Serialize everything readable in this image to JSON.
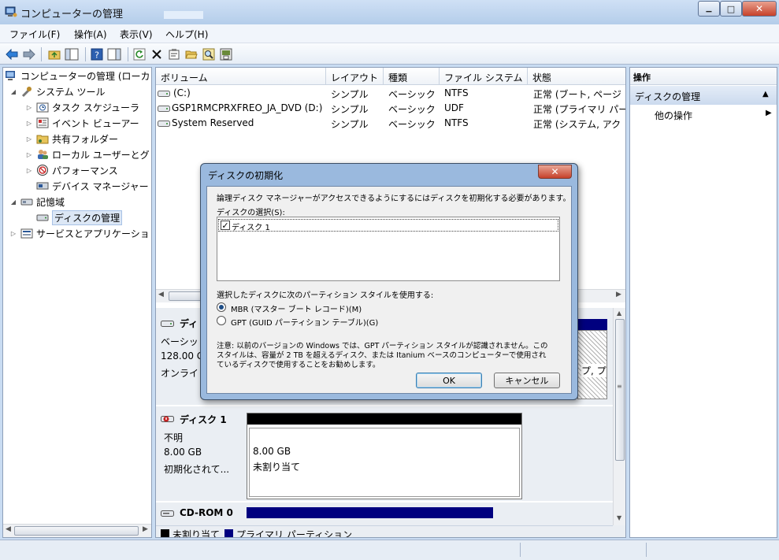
{
  "window": {
    "title": "コンピューターの管理",
    "minimize_label": "▁",
    "maximize_label": "□",
    "close_label": "✕"
  },
  "menu": [
    "ファイル(F)",
    "操作(A)",
    "表示(V)",
    "ヘルプ(H)"
  ],
  "tree": {
    "root": "コンピューターの管理 (ローカ",
    "system_tools": "システム ツール",
    "task_scheduler": "タスク スケジューラ",
    "event_viewer": "イベント ビューアー",
    "shared_folders": "共有フォルダー",
    "local_users": "ローカル ユーザーとグ",
    "performance": "パフォーマンス",
    "device_manager": "デバイス マネージャー",
    "storage": "記憶域",
    "disk_management": "ディスクの管理",
    "services_apps": "サービスとアプリケーショ"
  },
  "volumes": {
    "headers": {
      "volume": "ボリューム",
      "layout": "レイアウト",
      "type": "種類",
      "fs": "ファイル システム",
      "status": "状態"
    },
    "rows": [
      {
        "name": "(C:)",
        "layout": "シンプル",
        "type": "ベーシック",
        "fs": "NTFS",
        "status": "正常 (ブート, ページ"
      },
      {
        "name": "GSP1RMCPRXFREO_JA_DVD (D:)",
        "layout": "シンプル",
        "type": "ベーシック",
        "fs": "UDF",
        "status": "正常 (プライマリ パー"
      },
      {
        "name": "System Reserved",
        "layout": "シンプル",
        "type": "ベーシック",
        "fs": "NTFS",
        "status": "正常 (システム, アク"
      }
    ]
  },
  "disks": {
    "disk0": {
      "label": "ディ",
      "type": "ベーシッ",
      "size": "128.00 G",
      "status": "オンライ",
      "part_text": "プ, プ"
    },
    "disk1": {
      "label": "ディスク 1",
      "type": "不明",
      "size": "8.00 GB",
      "status": "初期化されて...",
      "part_size": "8.00 GB",
      "part_status": "未割り当て"
    },
    "cdrom": {
      "label": "CD-ROM 0"
    }
  },
  "legend": {
    "unallocated": "未割り当て",
    "primary": "プライマリ パーティション"
  },
  "colors": {
    "unallocated": "#000000",
    "primary": "#00007f"
  },
  "actions": {
    "header": "操作",
    "section": "ディスクの管理",
    "other": "他の操作"
  },
  "dialog": {
    "title": "ディスクの初期化",
    "intro": "論理ディスク マネージャーがアクセスできるようにするにはディスクを初期化する必要があります。",
    "select_label": "ディスクの選択(S):",
    "disk_item": "ディスク 1",
    "partition_label": "選択したディスクに次のパーティション スタイルを使用する:",
    "mbr": "MBR (マスター ブート レコード)(M)",
    "gpt": "GPT (GUID パーティション テーブル)(G)",
    "note_1": "注意: 以前のバージョンの Windows では、GPT パーティション スタイルが認識されません。この",
    "note_2": "スタイルは、容量が 2 TB を超えるディスク、または Itanium ベースのコンピューターで使用され",
    "note_3": "ているディスクで使用することをお勧めします。",
    "ok": "OK",
    "cancel": "キャンセル"
  }
}
